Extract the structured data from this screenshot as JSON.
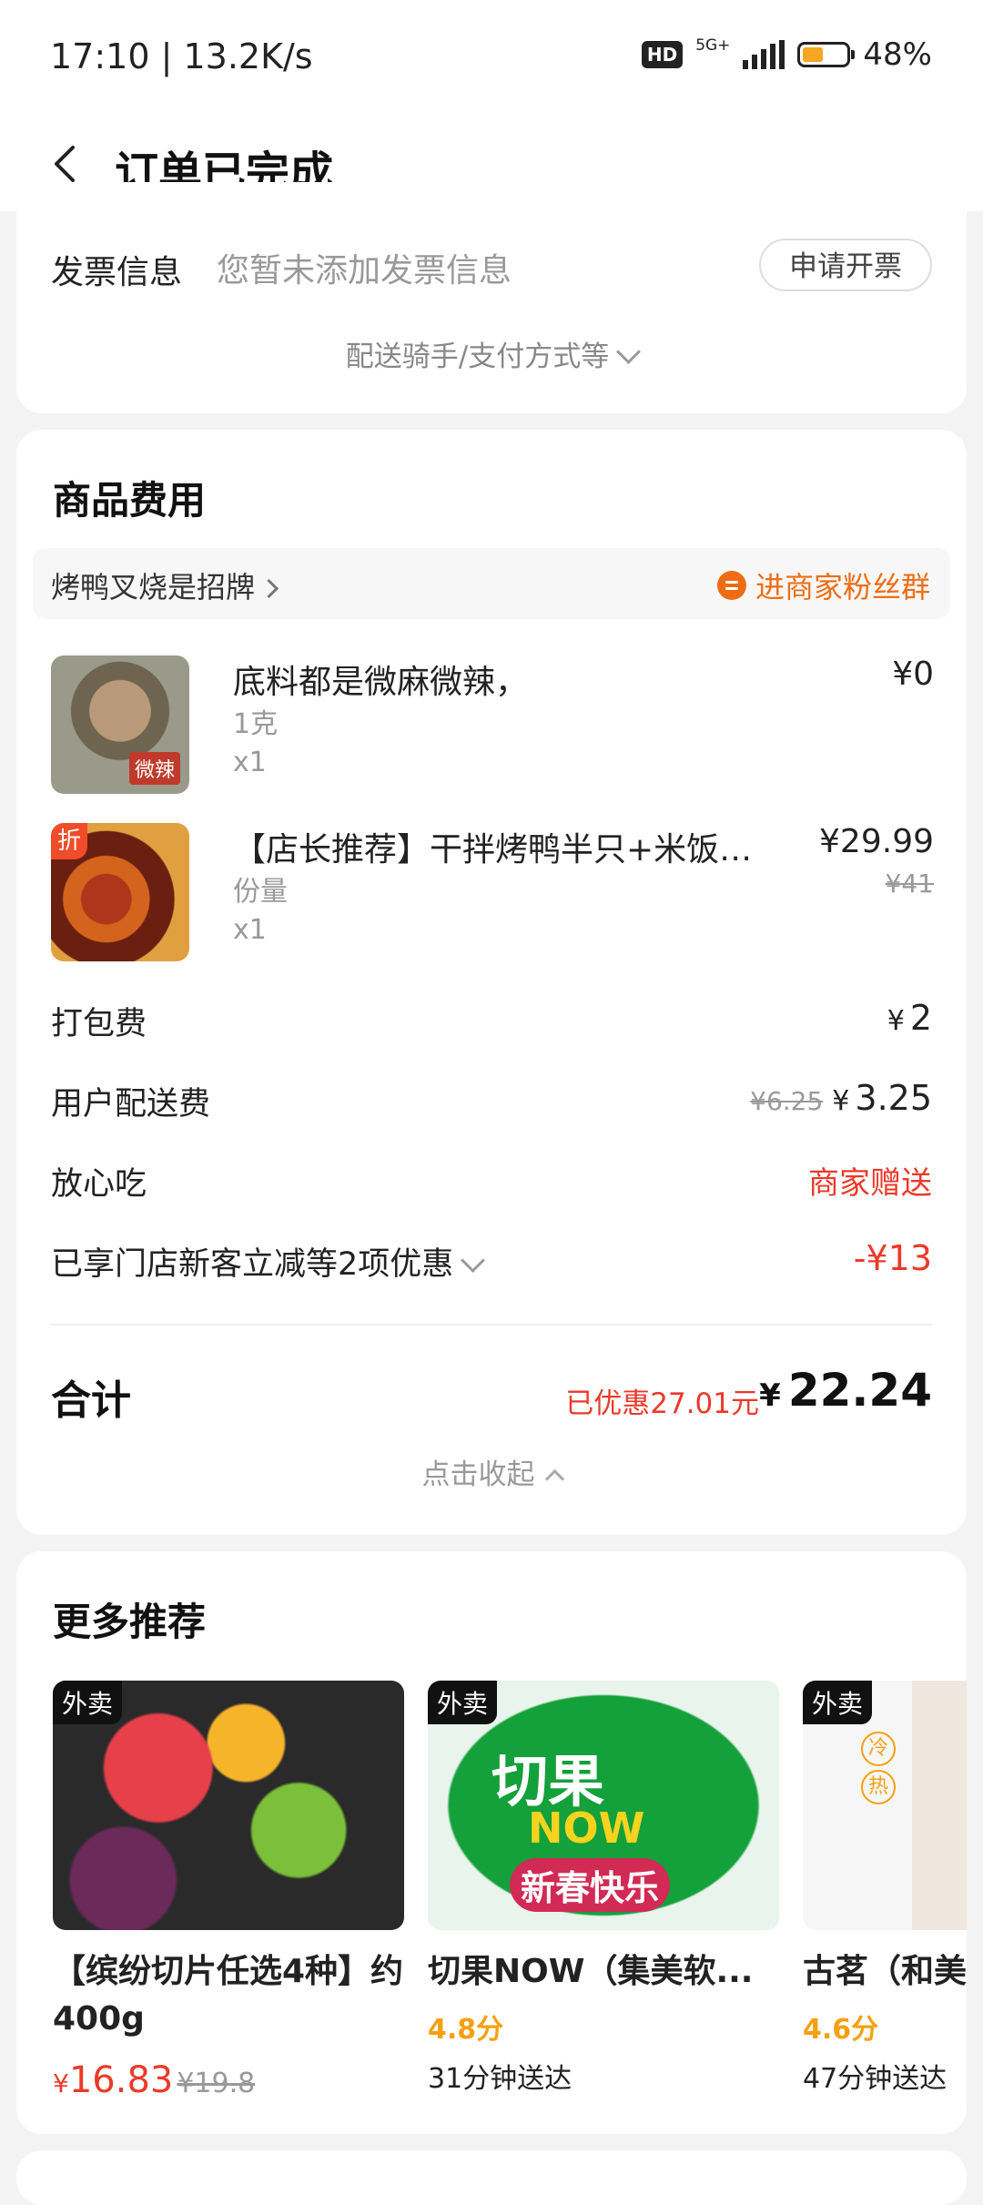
{
  "status_bar": {
    "time": "17:10 | 13.2K/s",
    "hd": "HD",
    "network": "5G+",
    "battery_pct": "48%",
    "battery_level": 0.48
  },
  "nav": {
    "title": "订单已完成"
  },
  "invoice": {
    "label": "发票信息",
    "placeholder": "您暂未添加发票信息",
    "apply_button": "申请开票",
    "expand_more": "配送骑手/支付方式等"
  },
  "goods": {
    "section_title": "商品费用",
    "store_name": "烤鸭叉烧是招牌",
    "fans_link": "进商家粉丝群",
    "items": [
      {
        "name": "底料都是微麻微辣，",
        "spec": "1克",
        "qty": "x1",
        "price": "¥0",
        "thumb_tag": "微辣"
      },
      {
        "name": "【店长推荐】干拌烤鸭半只+米饭+锅...",
        "spec": "份量",
        "qty": "x1",
        "price": "¥29.99",
        "orig_price": "¥41",
        "corner_tag": "折"
      }
    ],
    "fees": {
      "packing": {
        "label": "打包费",
        "yen": "¥",
        "value": "2"
      },
      "delivery": {
        "label": "用户配送费",
        "orig": "¥6.25",
        "yen": "¥",
        "value": "3.25"
      },
      "safe_eat": {
        "label": "放心吃",
        "value": "商家赠送"
      },
      "discount": {
        "label": "已享门店新客立减等2项优惠",
        "value": "-¥13"
      }
    },
    "total": {
      "label": "合计",
      "saved": "已优惠27.01元",
      "yen": "¥",
      "value": "22.24"
    },
    "collapse": "点击收起"
  },
  "recommend": {
    "section_title": "更多推荐",
    "items": [
      {
        "tag": "外卖",
        "title": "【缤纷切片任选4种】约400g",
        "yen": "¥",
        "price": "16.83",
        "orig_price": "¥19.8"
      },
      {
        "tag": "外卖",
        "title": "切果NOW（集美软...",
        "score": "4.8分",
        "eta": "31分钟送达",
        "logo_line1": "切果",
        "logo_line2": "NOW",
        "logo_line3": "新春快乐"
      },
      {
        "tag": "外卖",
        "title": "古茗（和美",
        "score": "4.6分",
        "eta": "47分钟送达",
        "badge_cold": "冷",
        "badge_hot": "热"
      }
    ]
  },
  "colors": {
    "accent_red": "#ea3a2a",
    "accent_orange": "#ee6d14",
    "score_orange": "#f5a010",
    "background": "#f3f3f3"
  }
}
